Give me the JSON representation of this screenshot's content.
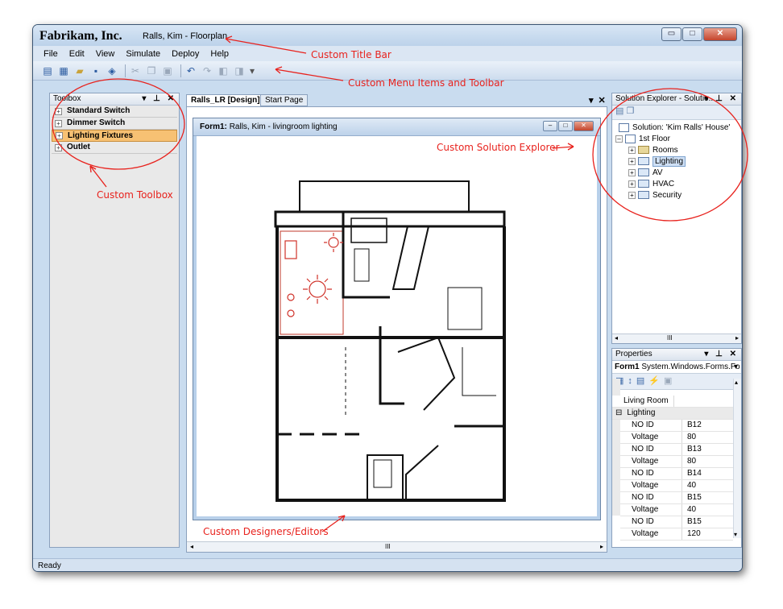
{
  "window": {
    "app_title": "Fabrikam, Inc.",
    "doc_title": "Ralls, Kim - Floorplan",
    "controls": {
      "minimize": "▭",
      "maximize": "□",
      "close": "✕"
    }
  },
  "menu": {
    "items": [
      "File",
      "Edit",
      "View",
      "Simulate",
      "Deploy",
      "Help"
    ]
  },
  "toolbar": {
    "icons": [
      "new-project-icon",
      "add-item-icon",
      "open-icon",
      "save-icon",
      "save-all-icon",
      "cut-icon",
      "copy-icon",
      "paste-icon",
      "undo-icon",
      "redo-icon",
      "navigate-back-icon",
      "navigate-forward-icon",
      "toolbar-options-icon"
    ]
  },
  "toolbox": {
    "title": "Toolbox",
    "items": [
      {
        "label": "Standard Switch"
      },
      {
        "label": "Dimmer Switch"
      },
      {
        "label": "Lighting Fixtures",
        "selected": true
      },
      {
        "label": "Outlet"
      }
    ]
  },
  "document": {
    "tabs": [
      {
        "label": "Ralls_LR [Design]*",
        "active": true
      },
      {
        "label": "Start Page",
        "active": false
      }
    ],
    "form": {
      "name": "Form1:",
      "caption": "Ralls, Kim - livingroom lighting"
    },
    "scrollbar_label": "III"
  },
  "solution_explorer": {
    "title": "Solution Explorer - Solutio...",
    "tree": {
      "solution": "Solution: 'Kim Ralls' House'",
      "floor": "1st Floor",
      "children": [
        {
          "label": "Rooms"
        },
        {
          "label": "Lighting",
          "selected": true
        },
        {
          "label": "AV"
        },
        {
          "label": "HVAC"
        },
        {
          "label": "Security"
        }
      ]
    },
    "scrollbar_label": "III"
  },
  "properties": {
    "title": "Properties",
    "object": {
      "name": "Form1",
      "type": "System.Windows.Forms.Fo"
    },
    "name_row": "Living Room",
    "category": "Lighting",
    "rows": [
      {
        "key": "NO ID",
        "value": "B12"
      },
      {
        "key": "Voltage",
        "value": "80"
      },
      {
        "key": "NO ID",
        "value": "B13"
      },
      {
        "key": "Voltage",
        "value": "80"
      },
      {
        "key": "NO ID",
        "value": "B14"
      },
      {
        "key": "Voltage",
        "value": "40"
      },
      {
        "key": "NO ID",
        "value": "B15"
      },
      {
        "key": "Voltage",
        "value": "40"
      },
      {
        "key": "NO ID",
        "value": "B15"
      },
      {
        "key": "Voltage",
        "value": "120"
      }
    ]
  },
  "status": {
    "text": "Ready"
  },
  "annotations": {
    "title_bar": "Custom Title Bar",
    "menu_toolbar": "Custom Menu Items and Toolbar",
    "toolbox": "Custom Toolbox",
    "solution_explorer": "Custom Solution Explorer",
    "designers": "Custom Designers/Editors"
  },
  "colors": {
    "annotation": "#e8221d",
    "selected_toolbox": "#f7c173",
    "window_frame": "#c9dcef"
  }
}
